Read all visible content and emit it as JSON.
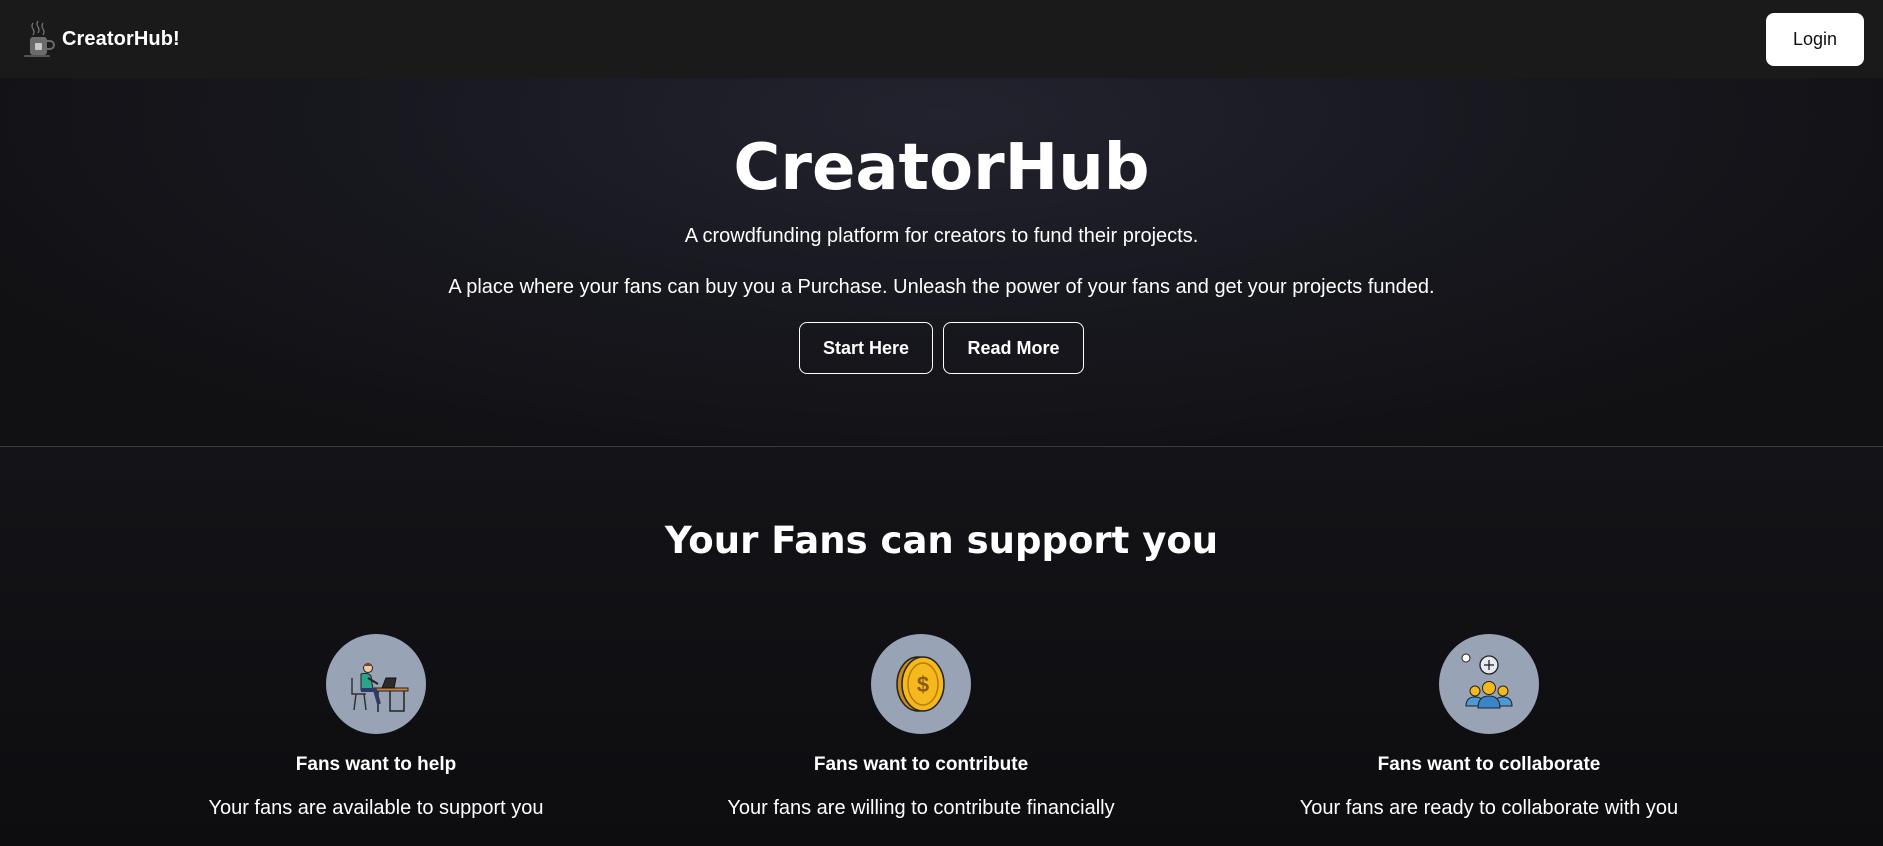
{
  "navbar": {
    "brand_name": "CreatorHub!",
    "brand_icon": "tea-cup-icon",
    "login_label": "Login"
  },
  "hero": {
    "title": "CreatorHub",
    "tagline": "A crowdfunding platform for creators to fund their projects.",
    "description": "A place where your fans can buy you a Purchase. Unleash the power of your fans and get your projects funded.",
    "start_label": "Start Here",
    "read_more_label": "Read More"
  },
  "features": {
    "title": "Your Fans can support you",
    "items": [
      {
        "icon": "person-at-desk-icon",
        "title": "Fans want to help",
        "text": "Your fans are available to support you"
      },
      {
        "icon": "coin-icon",
        "title": "Fans want to contribute",
        "text": "Your fans are willing to contribute financially"
      },
      {
        "icon": "group-collaborate-icon",
        "title": "Fans want to collaborate",
        "text": "Your fans are ready to collaborate with you"
      }
    ]
  },
  "colors": {
    "navbar_bg": "#1a1a1a",
    "icon_circle": "#98a3b5",
    "text": "#ffffff"
  }
}
